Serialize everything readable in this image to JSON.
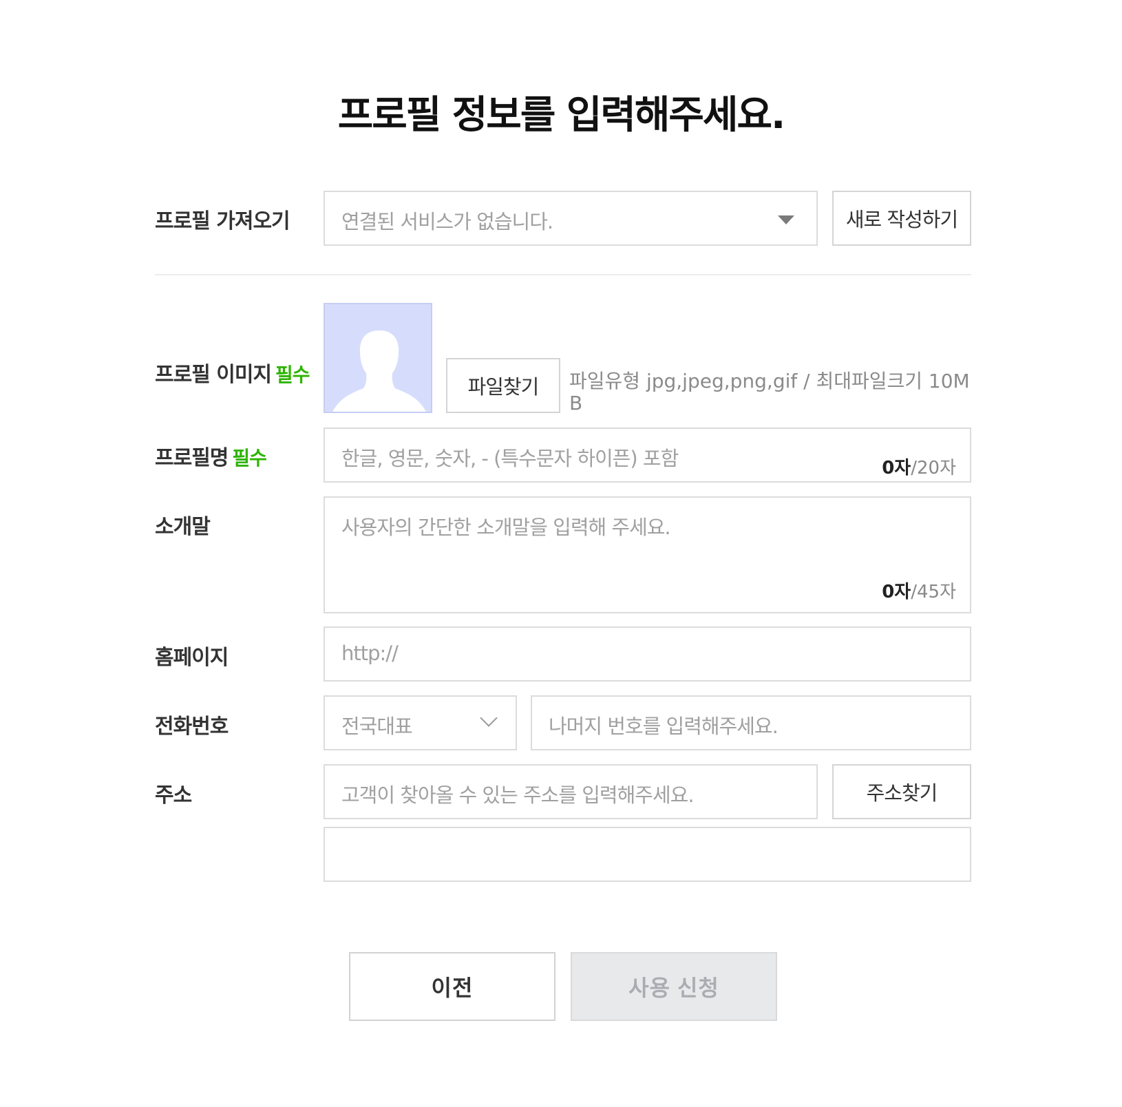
{
  "page": {
    "title": "프로필 정보를 입력해주세요."
  },
  "import_profile": {
    "label": "프로필 가져오기",
    "select_value": "연결된 서비스가 없습니다.",
    "new_button": "새로 작성하기"
  },
  "profile_image": {
    "label": "프로필 이미지",
    "required": "필수",
    "find_button": "파일찾기",
    "file_info": "파일유형 jpg,jpeg,png,gif / 최대파일크기 10MB"
  },
  "profile_name": {
    "label": "프로필명",
    "required": "필수",
    "placeholder": "한글, 영문, 숫자, - (특수문자 하이픈) 포함",
    "count": "0자",
    "max": "/20자"
  },
  "intro": {
    "label": "소개말",
    "placeholder": "사용자의 간단한 소개말을 입력해 주세요.",
    "count": "0자",
    "max": "/45자"
  },
  "homepage": {
    "label": "홈페이지",
    "placeholder": "http://"
  },
  "phone": {
    "label": "전화번호",
    "area_value": "전국대표",
    "placeholder": "나머지 번호를 입력해주세요."
  },
  "address": {
    "label": "주소",
    "placeholder": "고객이 찾아올 수 있는 주소를 입력해주세요.",
    "find_button": "주소찾기",
    "detail_value": ""
  },
  "actions": {
    "prev": "이전",
    "submit": "사용 신청"
  },
  "colors": {
    "required": "#2db400",
    "avatar_bg": "#d6ddfc",
    "border": "#dcdcdc",
    "submit_bg": "#e8e9eb"
  }
}
